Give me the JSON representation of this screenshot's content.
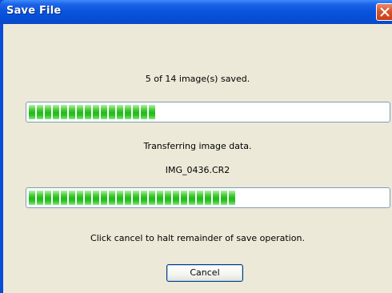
{
  "window": {
    "title": "Save File"
  },
  "status": {
    "images_saved_text": "5 of 14 image(s) saved.",
    "images_progress_fraction": 0.3571,
    "transfer_status_text": "Transferring image data.",
    "current_file_name": "IMG_0436.CR2",
    "file_progress_fraction": 0.58,
    "instruction_text": "Click cancel to halt remainder of save operation."
  },
  "buttons": {
    "cancel_label": "Cancel"
  },
  "colors": {
    "titlebar": "#0a55dc",
    "client_background": "#ece9d8",
    "progress_fill": "#22b81a",
    "close_button": "#d9542b"
  },
  "icons": {
    "close": "close-icon"
  }
}
